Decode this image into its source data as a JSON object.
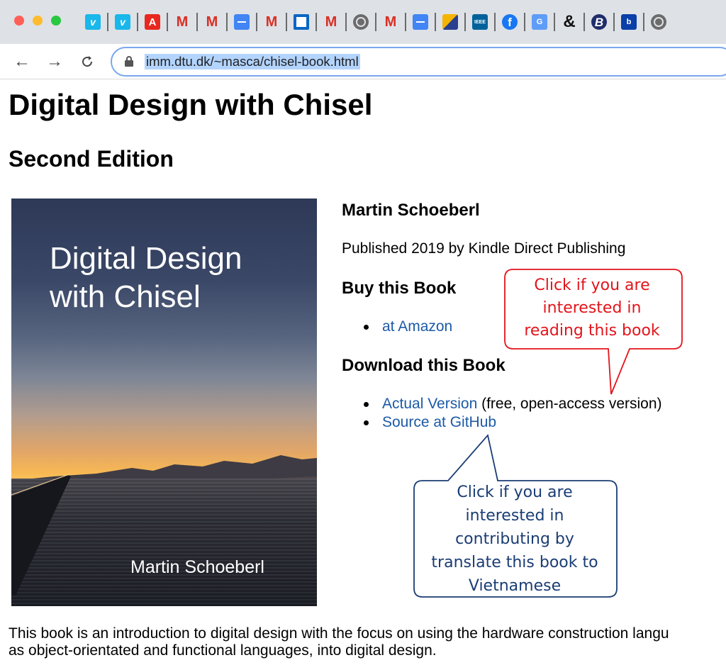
{
  "browser": {
    "bookmarks": [
      {
        "icon": "vimeo-icon",
        "glyph": "v"
      },
      {
        "icon": "vimeo-icon",
        "glyph": "v"
      },
      {
        "icon": "adobe-icon",
        "glyph": "A"
      },
      {
        "icon": "gmail-icon",
        "glyph": "M"
      },
      {
        "icon": "gmail-icon",
        "glyph": "M"
      },
      {
        "icon": "google-docs-icon",
        "glyph": ""
      },
      {
        "icon": "gmail-icon",
        "glyph": "M"
      },
      {
        "icon": "square-app-icon",
        "glyph": ""
      },
      {
        "icon": "gmail-icon",
        "glyph": "M"
      },
      {
        "icon": "globe-icon",
        "glyph": ""
      },
      {
        "icon": "gmail-icon",
        "glyph": "M"
      },
      {
        "icon": "google-docs-icon",
        "glyph": ""
      },
      {
        "icon": "rz-app-icon",
        "glyph": ""
      },
      {
        "icon": "ieee-icon",
        "glyph": "IEEE"
      },
      {
        "icon": "facebook-icon",
        "glyph": "f"
      },
      {
        "icon": "google-translate-icon",
        "glyph": "G"
      },
      {
        "icon": "ampersand-icon",
        "glyph": "&"
      },
      {
        "icon": "b-app-icon",
        "glyph": "B"
      },
      {
        "icon": "blue-app-icon",
        "glyph": "b"
      },
      {
        "icon": "globe-icon",
        "glyph": ""
      }
    ],
    "url": "imm.dtu.dk/~masca/chisel-book.html",
    "nav": {
      "back": "←",
      "forward": "→",
      "reload": "C"
    }
  },
  "page": {
    "title": "Digital Design with Chisel",
    "subtitle": "Second Edition",
    "cover": {
      "title_line1": "Digital Design",
      "title_line2": "with Chisel",
      "author": "Martin Schoeberl"
    },
    "author": "Martin Schoeberl",
    "published": "Published 2019 by Kindle Direct Publishing",
    "buy_heading": "Buy this Book",
    "buy_links": [
      {
        "text": "at Amazon"
      }
    ],
    "download_heading": "Download this Book",
    "download_links": [
      {
        "text": "Actual Version",
        "suffix": " (free, open-access version)"
      },
      {
        "text": "Source at GitHub",
        "suffix": ""
      }
    ],
    "intro_line1": "This book is an introduction to digital design with the focus on using the hardware construction langu",
    "intro_line2": "as object-orientated and functional languages, into digital design."
  },
  "callouts": {
    "red": {
      "lines": [
        "Click if you are",
        "interested in",
        "reading this book"
      ],
      "color": "#e2141b"
    },
    "blue": {
      "lines": [
        "Click if you are",
        "interested in",
        "contributing by",
        "translate this book to",
        "Vietnamese"
      ],
      "color": "#1a3d74"
    }
  }
}
